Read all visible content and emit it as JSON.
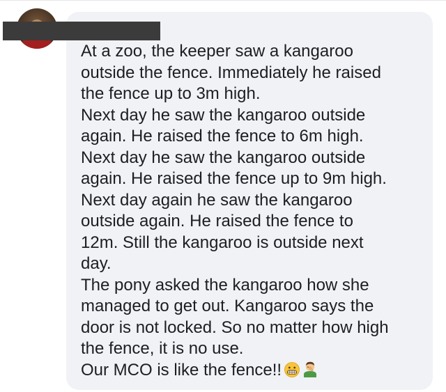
{
  "comment": {
    "lines": [
      "At a zoo, the keeper saw a kangaroo",
      "outside the fence. Immediately he raised",
      "the fence up to 3m high.",
      "Next day he saw the kangaroo outside",
      "again. He raised the fence to 6m high.",
      "Next day he saw the kangaroo outside",
      "again. He raised the fence up to 9m high.",
      "Next day again he saw the kangaroo",
      "outside again. He raised the fence to",
      "12m. Still the kangaroo is outside next",
      "day.",
      "The pony asked the kangaroo how she",
      "managed to get out. Kangaroo says the",
      "door is not locked. So no matter how high",
      "the fence, it is no use.",
      "Our MCO is like the fence!!"
    ],
    "emojis": [
      "grimacing-face-emoji",
      "man-facepalming-emoji"
    ]
  }
}
